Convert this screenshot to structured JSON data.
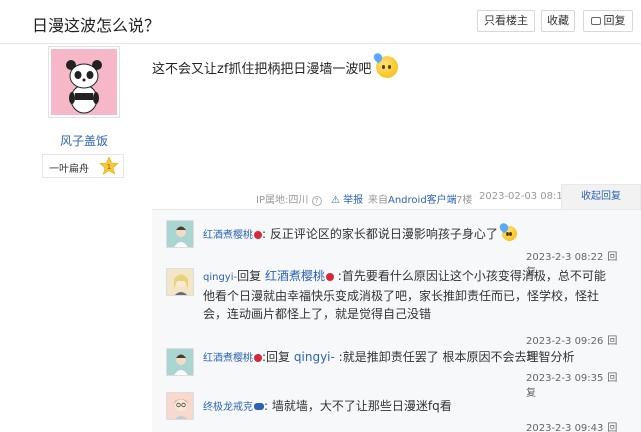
{
  "thread": {
    "title": "日漫这波怎么说？"
  },
  "toolbar": {
    "only_op": "只看楼主",
    "favorite": "收藏",
    "reply": "回复"
  },
  "post": {
    "author": {
      "name": "风子盖饭",
      "level_name": "一叶扁舟",
      "level": "1"
    },
    "content": "这不会又让zf抓住把柄把日漫墙一波吧",
    "meta": {
      "ip": "IP属地:四川",
      "report": "举报",
      "from_prefix": "来自",
      "from_source": "Android客户端",
      "floor": "7楼",
      "time": "2023-02-03 08:17",
      "collapse": "收起回复"
    }
  },
  "replies": [
    {
      "user": "红酒煮樱桃",
      "text": ": 反正评论区的家长都说日漫影响孩子身心了",
      "reply_to": "",
      "time": "2023-2-3 08:22",
      "reply_label": "回复"
    },
    {
      "user": "qingyi-",
      "reply_word": "回复",
      "reply_to": "红酒煮樱桃",
      "text": " :首先要看什么原因让这个小孩变得消极，总不可能他看个日漫就由幸福快乐变成消极了吧，家长推卸责任而已，怪学校，怪社会，连动画片都怪上了，就是觉得自己没错",
      "time": "2023-2-3 09:26",
      "reply_label": "回复"
    },
    {
      "user": "红酒煮樱桃",
      "reply_word": "回复",
      "reply_to": "qingyi-",
      "text": " :就是推卸责任罢了 根本原因不会去理智分析",
      "time": "2023-2-3 09:35",
      "reply_label": "回复"
    },
    {
      "user": "终极龙戒克",
      "text": ": 墙就墙，大不了让那些日漫迷fq看",
      "reply_to": "",
      "time": "2023-2-3 09:43",
      "reply_label": "回复"
    }
  ]
}
